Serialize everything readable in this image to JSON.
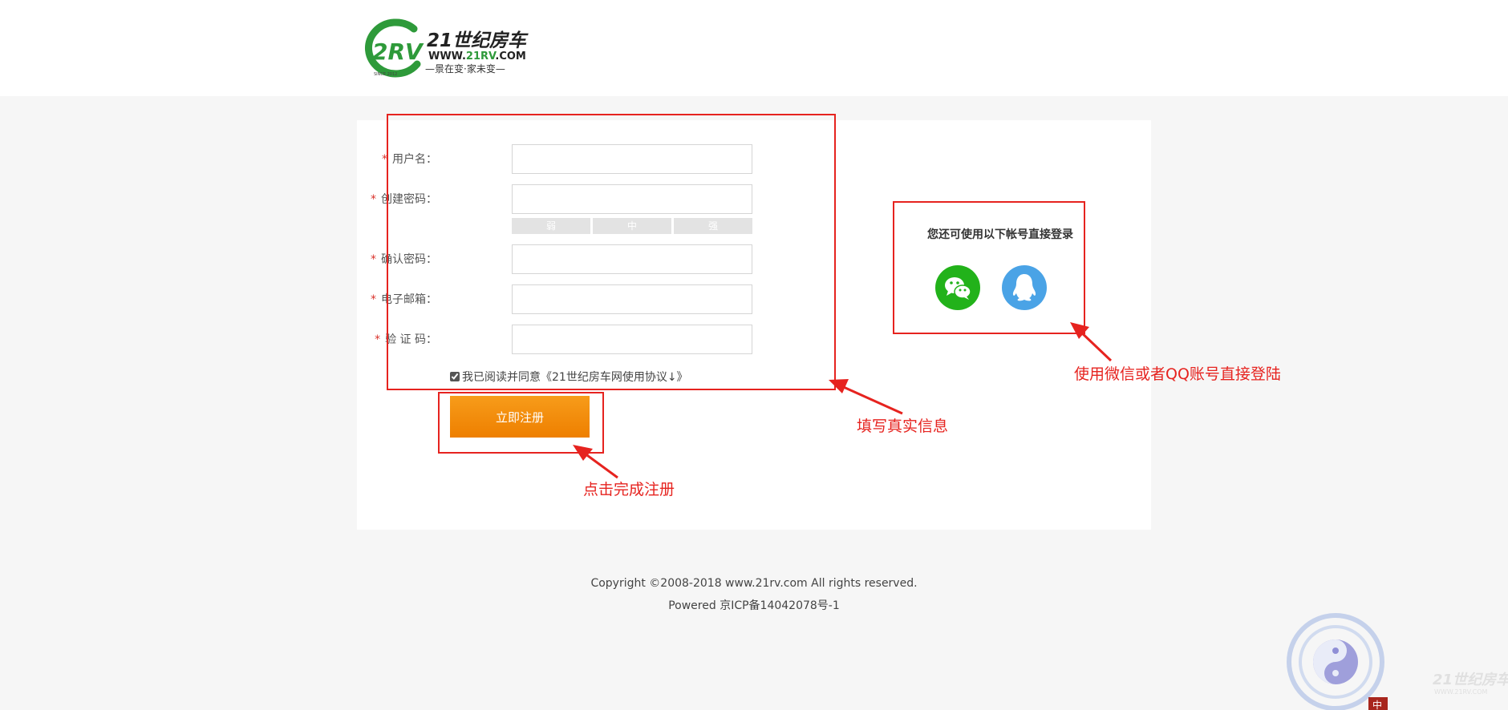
{
  "header": {
    "logo": {
      "mark_text": "2RV",
      "brand_name": "21世纪房车",
      "url_prefix": "WWW.",
      "url_highlight": "21RV",
      "url_suffix": ".COM",
      "slogan": "—景在变·家未变—",
      "since": "SINCE 2012"
    }
  },
  "form": {
    "fields": [
      {
        "label": "用户名：",
        "required_mark": "*",
        "value": "",
        "placeholder": ""
      },
      {
        "label": "创建密码：",
        "required_mark": "*",
        "value": "",
        "placeholder": ""
      },
      {
        "label": "确认密码：",
        "required_mark": "*",
        "value": "",
        "placeholder": ""
      },
      {
        "label": "电子邮箱：",
        "required_mark": "*",
        "value": "",
        "placeholder": ""
      },
      {
        "label": "验 证 码：",
        "required_mark": "*",
        "value": "",
        "placeholder": ""
      }
    ],
    "password_strength": [
      "弱",
      "中",
      "强"
    ],
    "agreement_text": "我已阅读并同意《21世纪房车网使用协议↓》",
    "agreement_checked": true,
    "submit_label": "立即注册"
  },
  "social": {
    "title": "您还可使用以下帐号直接登录",
    "providers": [
      {
        "name": "wechat-icon",
        "color": "#22b21a"
      },
      {
        "name": "qq-icon",
        "color": "#4aa3e6"
      }
    ]
  },
  "annotations": {
    "form_note": "填写真实信息",
    "submit_note": "点击完成注册",
    "social_note": "使用微信或者QQ账号直接登陆",
    "color": "#e6231f"
  },
  "footer": {
    "copyright": "Copyright ©2008-2018 www.21rv.com All rights reserved.",
    "icp": "Powered 京ICP备14042078号-1"
  },
  "watermark": {
    "seal_char": "中",
    "brand_name": "21世纪房车",
    "url": "WWW.21RV.COM"
  }
}
